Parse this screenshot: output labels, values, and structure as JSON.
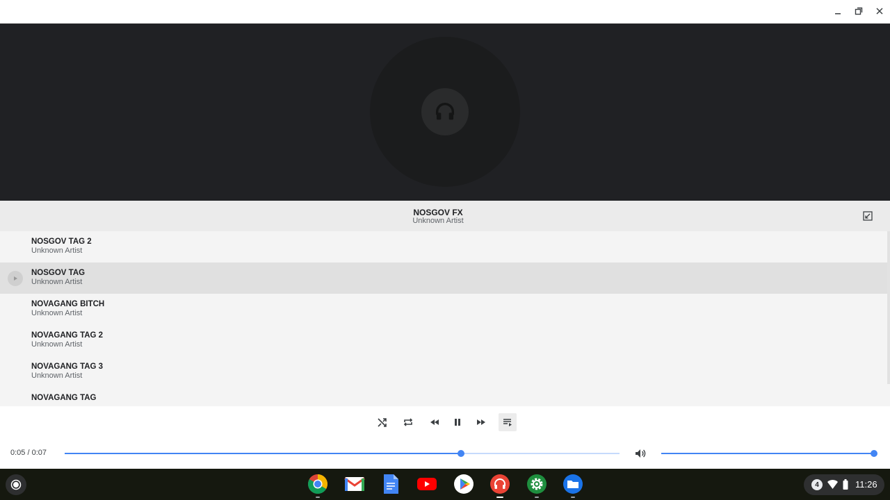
{
  "window": {
    "minimize_icon": "minimize-icon",
    "restore_icon": "restore-icon",
    "close_icon": "close-icon"
  },
  "now_playing": {
    "title": "NOSGOV FX",
    "artist": "Unknown Artist"
  },
  "tracks": [
    {
      "title": "NOSGOV TAG 2",
      "artist": "Unknown Artist"
    },
    {
      "title": "NOSGOV TAG",
      "artist": "Unknown Artist",
      "active": true
    },
    {
      "title": "NOVAGANG BITCH",
      "artist": "Unknown Artist"
    },
    {
      "title": "NOVAGANG TAG 2",
      "artist": "Unknown Artist"
    },
    {
      "title": "NOVAGANG TAG 3",
      "artist": "Unknown Artist"
    },
    {
      "title": "NOVAGANG TAG",
      "artist": ""
    }
  ],
  "player": {
    "time": "0:05 / 0:07",
    "progress_fraction": 0.7143,
    "volume_fraction": 1.0
  },
  "colors": {
    "accent": "#4285f4",
    "art_background": "#202124",
    "shelf_background": "#15180f"
  },
  "shelf": {
    "apps": [
      "chrome",
      "gmail",
      "docs",
      "youtube",
      "play-store",
      "audio-player",
      "settings",
      "files"
    ],
    "notification_count": "4",
    "clock": "11:26"
  }
}
